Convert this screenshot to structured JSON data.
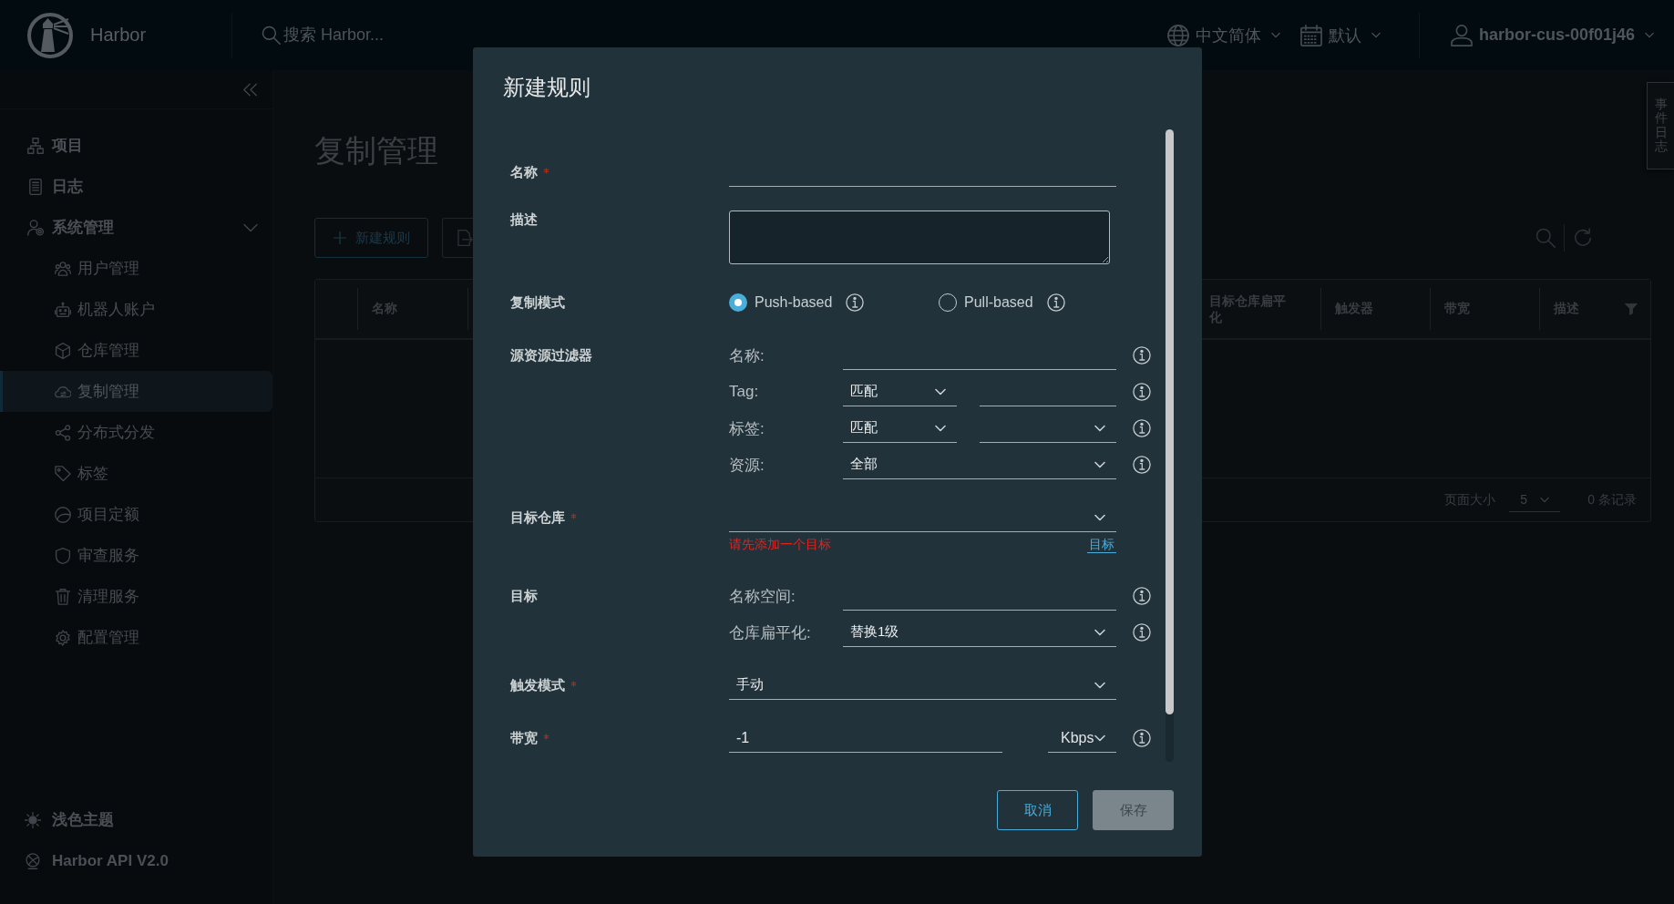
{
  "header": {
    "brand": "Harbor",
    "search": {
      "placeholder": "搜索 Harbor..."
    },
    "language": "中文简体",
    "date_format": "默认",
    "user": "harbor-cus-00f01j46"
  },
  "sidebar": {
    "items": [
      {
        "label": "项目",
        "selected": false
      },
      {
        "label": "日志",
        "selected": false
      },
      {
        "label": "系统管理",
        "selected": false,
        "expanded": true,
        "children": [
          {
            "label": "用户管理",
            "selected": false
          },
          {
            "label": "机器人账户",
            "selected": false
          },
          {
            "label": "仓库管理",
            "selected": false
          },
          {
            "label": "复制管理",
            "selected": true
          },
          {
            "label": "分布式分发",
            "selected": false
          },
          {
            "label": "标签",
            "selected": false
          },
          {
            "label": "项目定额",
            "selected": false
          },
          {
            "label": "审查服务",
            "selected": false
          },
          {
            "label": "清理服务",
            "selected": false
          },
          {
            "label": "配置管理",
            "selected": false
          }
        ]
      }
    ],
    "footer": [
      "浅色主题",
      "Harbor API V2.0"
    ]
  },
  "page": {
    "title": "复制管理",
    "actions": [
      "新建规则"
    ],
    "table": {
      "columns": [
        "名称",
        "目标仓库扁平化",
        "触发器",
        "带宽",
        "描述"
      ],
      "footer": {
        "page_size_label": "页面大小",
        "page_size": "5",
        "count": "0 条记录"
      }
    }
  },
  "event_log_tab": "事件日志",
  "dialog": {
    "title": "新建规则",
    "fields": [
      {
        "kind": "input",
        "label": "名称",
        "required": true
      },
      {
        "kind": "textarea",
        "label": "描述",
        "required": false
      },
      {
        "kind": "radio",
        "label": "复制模式",
        "required": false,
        "options": [
          {
            "label": "Push-based",
            "selected": true
          },
          {
            "label": "Pull-based",
            "selected": false
          }
        ]
      },
      {
        "kind": "group",
        "label": "源资源过滤器",
        "required": false,
        "rows": [
          {
            "label": "名称:",
            "controls": [
              {
                "kind": "input"
              }
            ]
          },
          {
            "label": "Tag:",
            "controls": [
              {
                "kind": "select",
                "value": "匹配"
              },
              {
                "kind": "input"
              }
            ]
          },
          {
            "label": "标签:",
            "controls": [
              {
                "kind": "select",
                "value": "匹配"
              },
              {
                "kind": "select"
              }
            ]
          },
          {
            "label": "资源:",
            "controls": [
              {
                "kind": "select",
                "value": "全部"
              }
            ]
          }
        ]
      },
      {
        "kind": "select",
        "label": "目标仓库",
        "required": true,
        "error": "请先添加一个目标",
        "link": "目标"
      },
      {
        "kind": "group",
        "label": "目标",
        "required": false,
        "rows": [
          {
            "label": "名称空间:",
            "controls": [
              {
                "kind": "input"
              }
            ]
          },
          {
            "label": "仓库扁平化:",
            "controls": [
              {
                "kind": "select",
                "value": "替换1级"
              }
            ]
          }
        ]
      },
      {
        "kind": "select",
        "label": "触发模式",
        "required": true,
        "value": "手动"
      },
      {
        "kind": "bandwidth",
        "label": "带宽",
        "required": true,
        "value": "-1",
        "unit": "Kbps"
      }
    ],
    "buttons": [
      {
        "label": "取消",
        "kind": "outline",
        "disabled": false
      },
      {
        "label": "保存",
        "kind": "solid",
        "disabled": true
      }
    ]
  }
}
